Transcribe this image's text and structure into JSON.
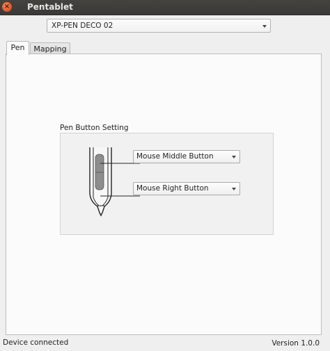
{
  "window": {
    "title": "Pentablet",
    "close_glyph": "×"
  },
  "device": {
    "selected": "XP-PEN DECO 02"
  },
  "tabs": [
    {
      "label": "Pen",
      "active": true
    },
    {
      "label": "Mapping",
      "active": false
    }
  ],
  "pen_settings": {
    "group_title": "Pen Button Setting",
    "upper_button": "Mouse Middle Button",
    "lower_button": "Mouse Right Button",
    "illustration_icon": "stylus-icon"
  },
  "status": {
    "connection": "Device connected",
    "version": "Version 1.0.0"
  }
}
